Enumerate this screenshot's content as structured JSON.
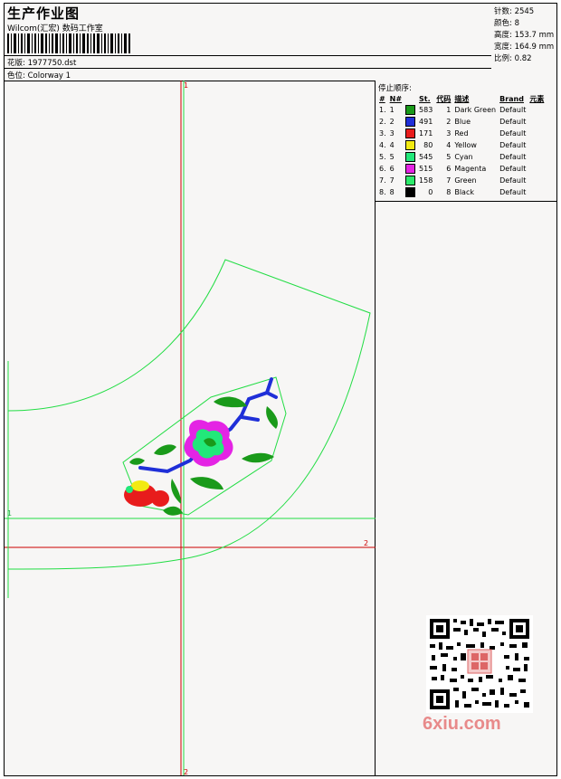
{
  "header": {
    "title": "生产作业图",
    "company": "Wilcom(汇宏) 数码工作室",
    "design_label": "花版:",
    "design_value": "1977750.dst",
    "colorway_label": "色位:",
    "colorway_value": "Colorway 1"
  },
  "stats": [
    {
      "label": "针数:",
      "value": "2545"
    },
    {
      "label": "颜色:",
      "value": "8"
    },
    {
      "label": "高度:",
      "value": "153.7 mm"
    },
    {
      "label": "宽度:",
      "value": "164.9 mm"
    },
    {
      "label": "比例:",
      "value": "0.82"
    }
  ],
  "sequence": {
    "title": "停止顺序:",
    "headers": [
      "#",
      "N#",
      "St.",
      "代码",
      "描述",
      "Brand",
      "元素"
    ],
    "rows": [
      {
        "num": "1.",
        "n": "1",
        "color": "#1a9a1a",
        "st": "583",
        "code": "1",
        "desc": "Dark Green",
        "brand": "Default"
      },
      {
        "num": "2.",
        "n": "2",
        "color": "#1f2fd8",
        "st": "491",
        "code": "2",
        "desc": "Blue",
        "brand": "Default"
      },
      {
        "num": "3.",
        "n": "3",
        "color": "#e81c1c",
        "st": "171",
        "code": "3",
        "desc": "Red",
        "brand": "Default"
      },
      {
        "num": "4.",
        "n": "4",
        "color": "#f2ea12",
        "st": "80",
        "code": "4",
        "desc": "Yellow",
        "brand": "Default"
      },
      {
        "num": "5.",
        "n": "5",
        "color": "#22e87a",
        "st": "545",
        "code": "5",
        "desc": "Cyan",
        "brand": "Default"
      },
      {
        "num": "6.",
        "n": "6",
        "color": "#e424e4",
        "st": "515",
        "code": "6",
        "desc": "Magenta",
        "brand": "Default"
      },
      {
        "num": "7.",
        "n": "7",
        "color": "#2cea6a",
        "st": "158",
        "code": "7",
        "desc": "Green",
        "brand": "Default"
      },
      {
        "num": "8.",
        "n": "8",
        "color": "#000000",
        "st": "0",
        "code": "8",
        "desc": "Black",
        "brand": "Default"
      }
    ]
  },
  "canvas": {
    "axis_v_top": "1",
    "axis_v_bottom": "2",
    "axis_h_left": "1",
    "axis_h_right": "2"
  },
  "watermark": "6xiu.com"
}
